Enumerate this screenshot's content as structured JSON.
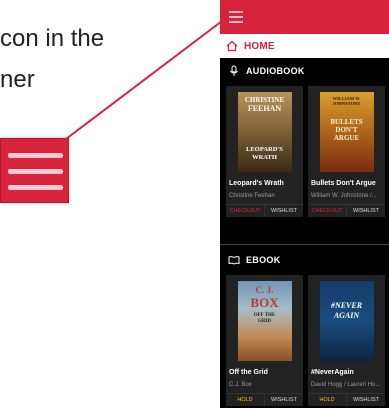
{
  "callout": {
    "line1": "con in the",
    "line2": "ner"
  },
  "colors": {
    "brand_red": "#d8233c",
    "screen_bg": "#000000",
    "hold_yellow": "#f5c400"
  },
  "app": {
    "menu_icon": "hamburger-icon",
    "home_label": "HOME",
    "home_icon": "home-icon"
  },
  "sections": [
    {
      "title": "AUDIOBOOK",
      "icon": "microphone-icon",
      "items": [
        {
          "title": "Leopard's Wrath",
          "author": "Christine Feehan",
          "cover_lines": [
            "CHRISTINE",
            "FEEHAN",
            "LEOPARD'S",
            "WRATH"
          ],
          "primary_action": "CHECKOUT",
          "secondary_action": "WISHLIST"
        },
        {
          "title": "Bullets Don't Argue",
          "author": "William W. Johnstone /...",
          "cover_lines": [
            "WILLIAM W.",
            "JOHNSTONE",
            "BULLETS",
            "DON'T",
            "ARGUE"
          ],
          "primary_action": "CHECKOUT",
          "secondary_action": "WISHLIST"
        }
      ]
    },
    {
      "title": "EBOOK",
      "icon": "open-book-icon",
      "items": [
        {
          "title": "Off the Grid",
          "author": "C.J. Box",
          "cover_lines": [
            "C. J.",
            "BOX",
            "OFF THE",
            "GRID"
          ],
          "primary_action": "HOLD",
          "secondary_action": "WISHLIST"
        },
        {
          "title": "#NeverAgain",
          "author": "David Hogg / Lauren Ho...",
          "cover_lines": [
            "#NEVER",
            "AGAIN"
          ],
          "primary_action": "HOLD",
          "secondary_action": "WISHLIST"
        }
      ]
    }
  ]
}
